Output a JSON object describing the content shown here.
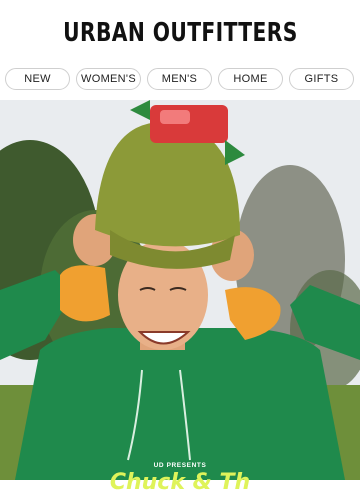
{
  "header": {
    "logo_text": "URBAN OUTFITTERS"
  },
  "nav": {
    "items": [
      {
        "label": "NEW"
      },
      {
        "label": "WOMEN'S"
      },
      {
        "label": "MEN'S"
      },
      {
        "label": "HOME"
      },
      {
        "label": "GIFTS"
      }
    ]
  },
  "hero": {
    "presents_text": "UD PRESENTS",
    "title_text": "Chuck & Th",
    "colors": {
      "hoodie": "#1f8a4c",
      "hat": "#8c9a38",
      "sky": "#e9ecef",
      "grass": "#6e8f3a",
      "title": "#dff35a"
    }
  }
}
